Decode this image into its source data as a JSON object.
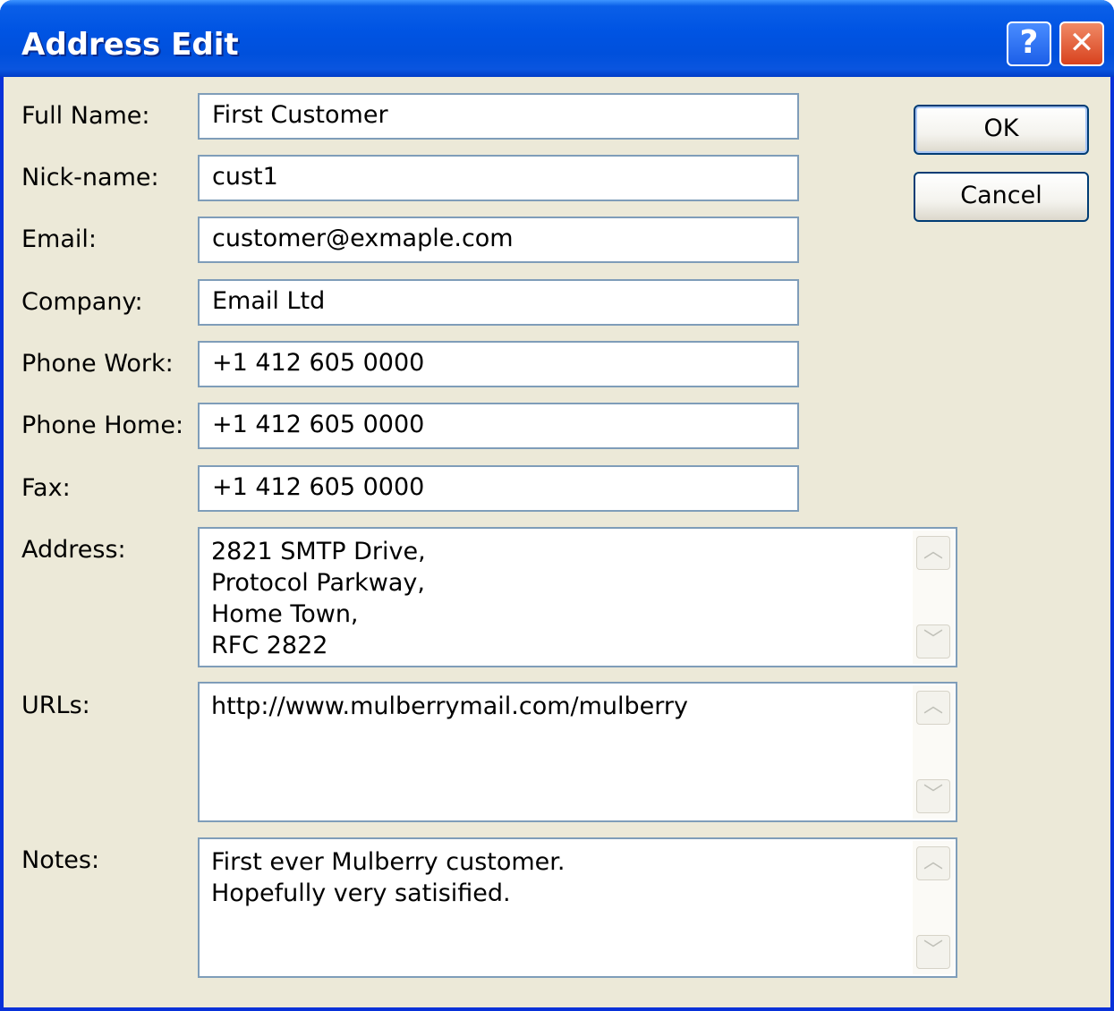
{
  "window": {
    "title": "Address Edit",
    "help_label": "?",
    "close_label": "✕"
  },
  "fields": {
    "full_name": {
      "label": "Full Name:",
      "value": "First Customer"
    },
    "nick_name": {
      "label": "Nick-name:",
      "value": "cust1"
    },
    "email": {
      "label": "Email:",
      "value": "customer@exmaple.com"
    },
    "company": {
      "label": "Company:",
      "value": "Email Ltd"
    },
    "phone_work": {
      "label": "Phone Work:",
      "value": "+1 412 605 0000"
    },
    "phone_home": {
      "label": "Phone Home:",
      "value": "+1 412 605 0000"
    },
    "fax": {
      "label": "Fax:",
      "value": "+1 412 605 0000"
    },
    "address": {
      "label": "Address:",
      "value": "2821 SMTP Drive,\nProtocol Parkway,\nHome Town,\nRFC 2822"
    },
    "urls": {
      "label": "URLs:",
      "value": "http://www.mulberrymail.com/mulberry"
    },
    "notes": {
      "label": "Notes:",
      "value": "First ever Mulberry customer.\nHopefully very satisified."
    }
  },
  "buttons": {
    "ok": "OK",
    "cancel": "Cancel"
  },
  "icons": {
    "scroll_up": "chevron-up-icon",
    "scroll_down": "chevron-down-icon"
  }
}
